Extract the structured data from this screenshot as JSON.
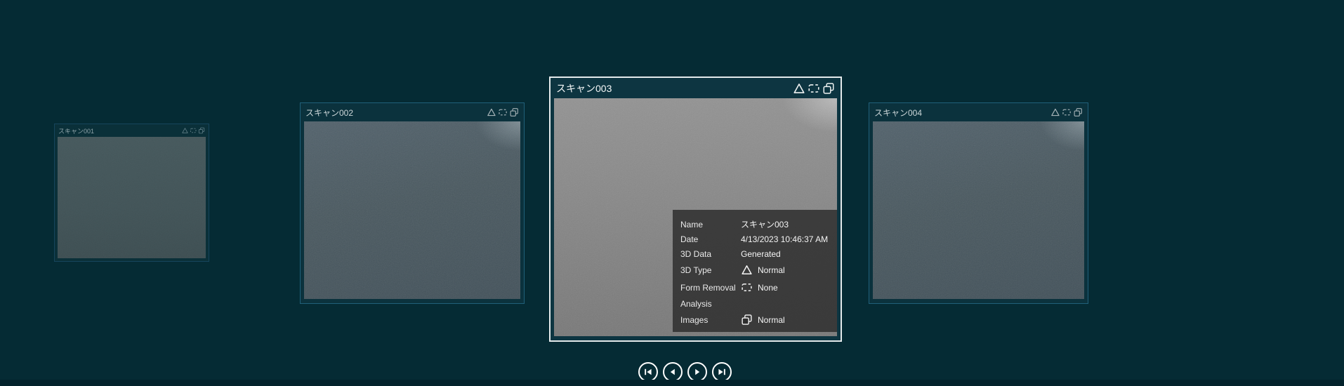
{
  "app": {
    "background_color": "#052b34",
    "selected_border_color": "#e4eaeb",
    "unselected_border_color": "#20607a",
    "panel_background": "rgba(45,45,45,0.84)"
  },
  "cards": [
    {
      "title": "スキャン001",
      "state": "inactive-far"
    },
    {
      "title": "スキャン002",
      "state": "inactive"
    },
    {
      "title": "スキャン003",
      "state": "selected"
    },
    {
      "title": "スキャン004",
      "state": "inactive"
    }
  ],
  "card_header_icons": [
    "triangle-icon",
    "form-removal-icon",
    "images-icon"
  ],
  "details_panel": {
    "rows": [
      {
        "label": "Name",
        "value": "スキャン003"
      },
      {
        "label": "Date",
        "value": "4/13/2023 10:46:37 AM"
      },
      {
        "label": "3D Data",
        "value": "Generated"
      },
      {
        "label": "3D Type",
        "icon": "triangle-icon",
        "value": "Normal"
      },
      {
        "label": "Form Removal",
        "icon": "form-removal-icon",
        "value": "None"
      },
      {
        "label": "Analysis",
        "value": ""
      },
      {
        "label": "Images",
        "icon": "images-icon",
        "value": "Normal"
      }
    ]
  },
  "nav": {
    "buttons": [
      {
        "name": "first",
        "icon": "skip-to-first-icon"
      },
      {
        "name": "previous",
        "icon": "previous-icon"
      },
      {
        "name": "next",
        "icon": "next-icon"
      },
      {
        "name": "last",
        "icon": "skip-to-last-icon"
      }
    ]
  }
}
